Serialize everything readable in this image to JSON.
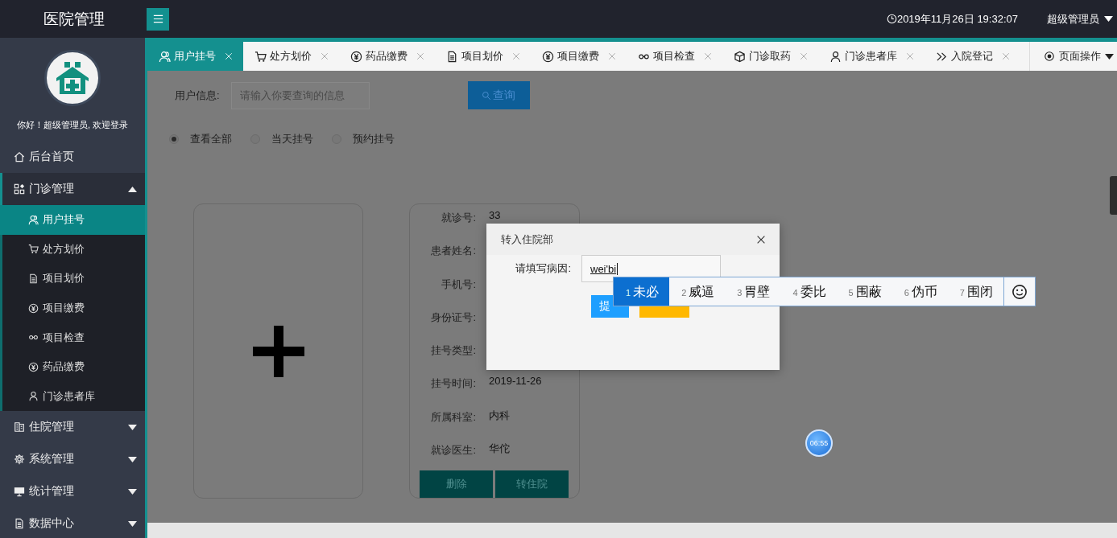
{
  "header": {
    "title": "医院管理",
    "datetime": "2019年11月26日 19:32:07",
    "user": "超级管理员"
  },
  "tabs": [
    {
      "label": "用户挂号",
      "selected": true
    },
    {
      "label": "处方划价",
      "selected": false
    },
    {
      "label": "药品缴费",
      "selected": false
    },
    {
      "label": "项目划价",
      "selected": false
    },
    {
      "label": "项目缴费",
      "selected": false
    },
    {
      "label": "项目检查",
      "selected": false
    },
    {
      "label": "门诊取药",
      "selected": false
    },
    {
      "label": "门诊患者库",
      "selected": false
    },
    {
      "label": "入院登记",
      "selected": false
    }
  ],
  "page_actions": {
    "label": "页面操作"
  },
  "sidebar": {
    "greeting": "你好！超级管理员, 欢迎登录",
    "items": [
      {
        "label": "后台首页"
      },
      {
        "label": "门诊管理",
        "expanded": true,
        "children": [
          {
            "label": "用户挂号",
            "selected": true
          },
          {
            "label": "处方划价",
            "selected": false
          },
          {
            "label": "项目划价",
            "selected": false
          },
          {
            "label": "项目缴费",
            "selected": false
          },
          {
            "label": "项目检查",
            "selected": false
          },
          {
            "label": "药品缴费",
            "selected": false
          },
          {
            "label": "门诊患者库",
            "selected": false
          }
        ]
      },
      {
        "label": "住院管理",
        "expanded": false
      },
      {
        "label": "系统管理",
        "expanded": false
      },
      {
        "label": "统计管理",
        "expanded": false
      },
      {
        "label": "数据中心",
        "expanded": false
      }
    ]
  },
  "search": {
    "label": "用户信息:",
    "placeholder": "请输入你要查询的信息",
    "button": "查询"
  },
  "filters": [
    {
      "label": "查看全部",
      "selected": true
    },
    {
      "label": "当天挂号",
      "selected": false
    },
    {
      "label": "预约挂号",
      "selected": false
    }
  ],
  "patient": {
    "fields": [
      {
        "label": "就诊号:",
        "value": "33"
      },
      {
        "label": "患者姓名:"
      },
      {
        "label": "手机号:"
      },
      {
        "label": "身份证号:"
      },
      {
        "label": "挂号类型:"
      },
      {
        "label": "挂号时间:",
        "value": "2019-11-26"
      },
      {
        "label": "所属科室:",
        "value": "内科"
      },
      {
        "label": "就诊医生:",
        "value": "华佗"
      }
    ],
    "buttons": [
      "删除",
      "转住院"
    ]
  },
  "dialog": {
    "title": "转入住院部",
    "field_label": "请填写病因:",
    "value": "wei'bi",
    "submit": "提"
  },
  "ime": {
    "candidates": [
      {
        "number": "1",
        "text": "未必",
        "selected": true
      },
      {
        "number": "2",
        "text": "威逼",
        "selected": false
      },
      {
        "number": "3",
        "text": "胃壁",
        "selected": false
      },
      {
        "number": "4",
        "text": "委比",
        "selected": false
      },
      {
        "number": "5",
        "text": "围蔽",
        "selected": false
      },
      {
        "number": "6",
        "text": "伪币",
        "selected": false
      },
      {
        "number": "7",
        "text": "围闭",
        "selected": false
      }
    ]
  },
  "recorder_badge": "06:55"
}
